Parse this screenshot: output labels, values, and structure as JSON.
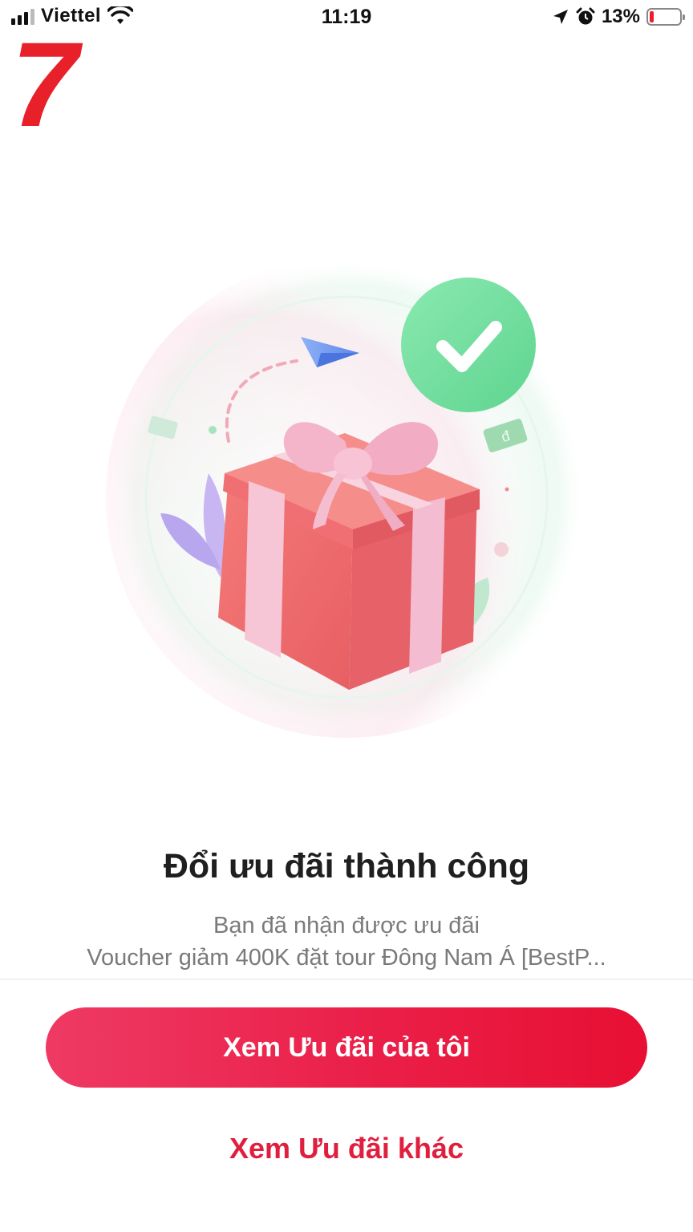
{
  "status_bar": {
    "carrier": "Viettel",
    "time": "11:19",
    "battery_percent": "13%",
    "battery_level": 0.13,
    "icons": [
      "signal-icon",
      "wifi-icon",
      "location-arrow-icon",
      "alarm-icon",
      "battery-icon"
    ]
  },
  "page_number": "7",
  "illustration": {
    "icons": [
      "gift-box-icon",
      "check-circle-icon",
      "paper-plane-icon",
      "money-note-icon",
      "leaf-icon"
    ]
  },
  "result": {
    "title": "Đổi ưu đãi thành công",
    "line1": "Bạn đã nhận được ưu đãi",
    "line2": "Voucher giảm 400K đặt tour Đông Nam Á [BestP..."
  },
  "actions": {
    "primary_label": "Xem Ưu đãi của tôi",
    "secondary_label": "Xem Ưu đãi khác"
  },
  "colors": {
    "accent": "#E8202A",
    "button_gradient_start": "#EE3A63",
    "button_gradient_end": "#E80F33",
    "check_green": "#6FDB9A",
    "gift_red": "#F0706E",
    "ribbon_pink": "#F6C6D6"
  }
}
